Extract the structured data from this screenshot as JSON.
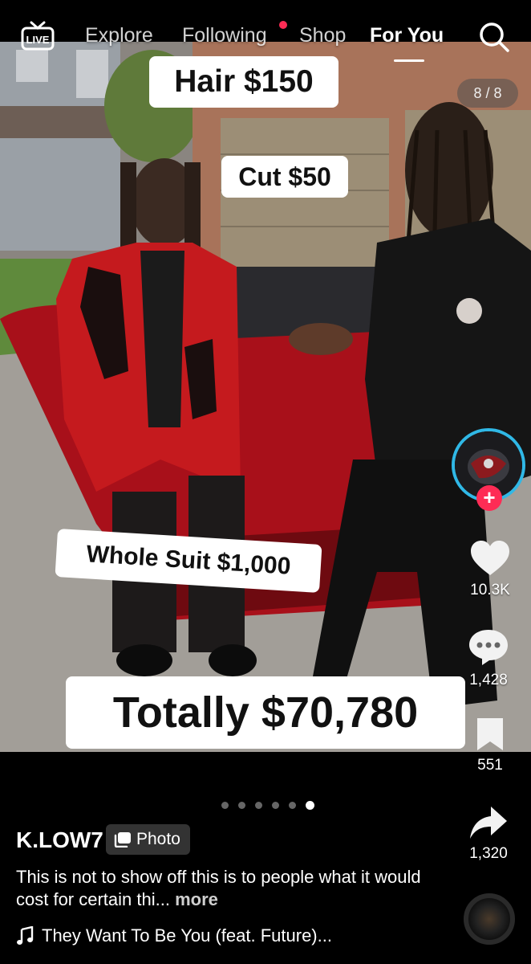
{
  "nav": {
    "live_label": "LIVE",
    "tabs": [
      {
        "label": "Explore"
      },
      {
        "label": "Following"
      },
      {
        "label": "Shop"
      },
      {
        "label": "For You"
      }
    ],
    "active_tab": "For You",
    "notification_color": "#fe2c55"
  },
  "post": {
    "counter": "8 / 8",
    "overlays": {
      "hair": "Hair $150",
      "cut": "Cut $50",
      "suit": "Whole Suit $1,000",
      "total": "Totally $70,780"
    },
    "slide_count": 6,
    "active_slide": 6
  },
  "actions": {
    "likes": "10.3K",
    "comments": "1,428",
    "bookmarks": "551",
    "shares": "1,320",
    "follow_symbol": "+"
  },
  "author": {
    "username": "K.LOW7",
    "badge": "Photo"
  },
  "caption": {
    "text": "This is not to show off this is to people what it would cost for certain thi...",
    "more": "more"
  },
  "music": {
    "title": "They Want To Be You (feat. Future)..."
  },
  "colors": {
    "accent": "#fe2c55",
    "avatar_ring": "#30b8e6",
    "background": "#000000"
  },
  "icons": [
    "live-icon",
    "search-icon",
    "heart-icon",
    "comment-icon",
    "bookmark-icon",
    "share-icon",
    "music-note-icon",
    "photo-icon"
  ]
}
